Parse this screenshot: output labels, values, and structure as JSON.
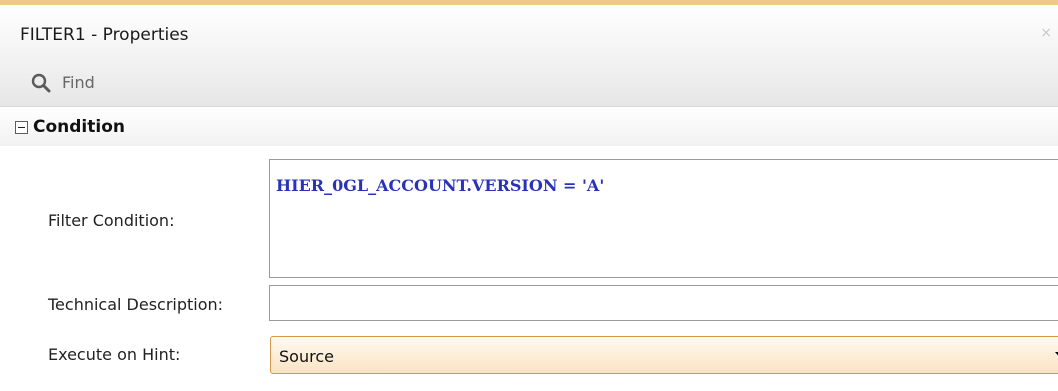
{
  "window": {
    "title": "FILTER1 - Properties",
    "close_glyph": "×"
  },
  "find": {
    "placeholder": "Find",
    "value": ""
  },
  "section": {
    "title": "Condition",
    "toggle_state": "expanded"
  },
  "fields": {
    "filter_condition": {
      "label": "Filter Condition:",
      "value": "HIER_0GL_ACCOUNT.VERSION = 'A'"
    },
    "technical_description": {
      "label": "Technical Description:",
      "value": ""
    },
    "execute_on_hint": {
      "label": "Execute on Hint:",
      "value": "Source"
    }
  },
  "icons": {
    "search": "search-icon",
    "close": "close-icon",
    "collapse": "collapse-icon",
    "dropdown": "chevron-down-icon"
  },
  "colors": {
    "accent": "#eec98a",
    "condition_text": "#2a33b8",
    "select_border": "#d39a4a"
  }
}
